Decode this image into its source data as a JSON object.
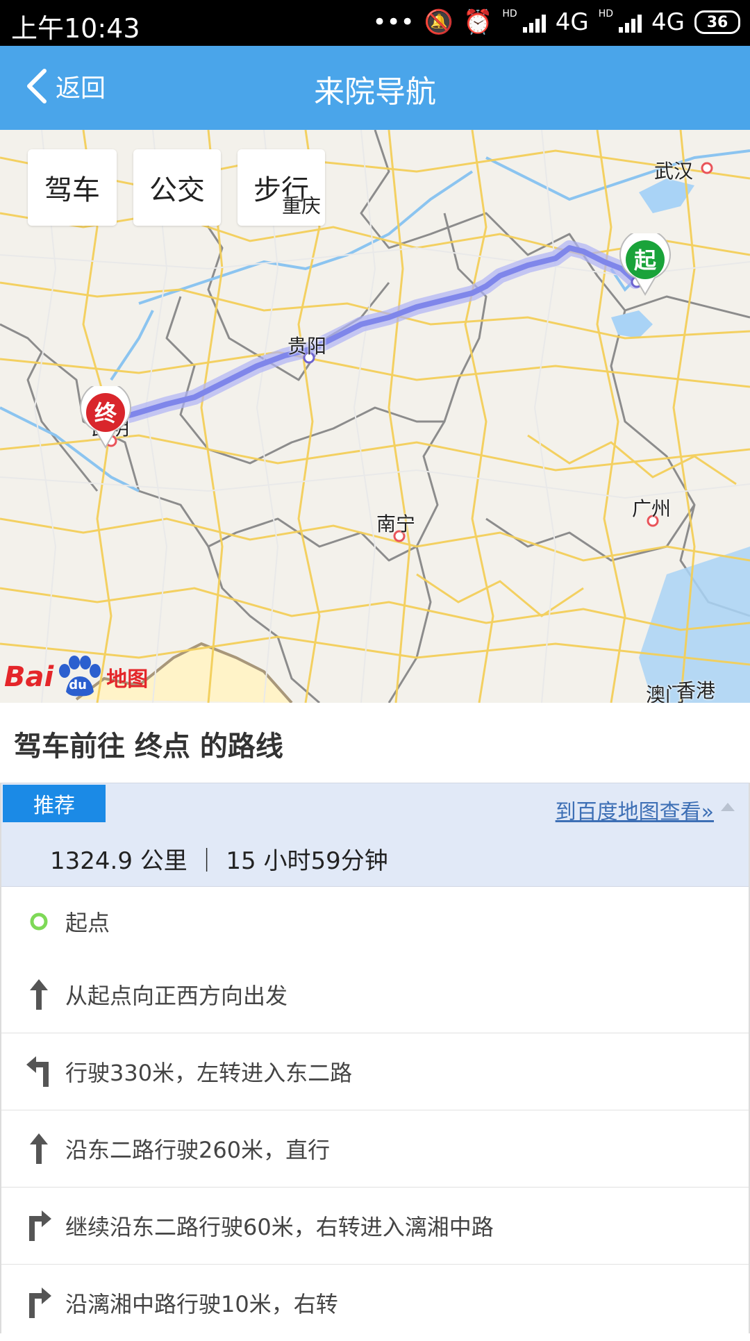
{
  "status_bar": {
    "time": "上午10:43",
    "network_1": "4G",
    "network_2": "4G",
    "hd": "HD",
    "battery": "36"
  },
  "header": {
    "back_label": "返回",
    "title": "来院导航"
  },
  "modes": [
    "驾车",
    "公交",
    "步行"
  ],
  "map": {
    "cities": [
      "武汉",
      "重庆",
      "贵阳",
      "昆明",
      "南宁",
      "广州",
      "澳门",
      "香港"
    ],
    "start_marker": "起",
    "end_marker": "终",
    "logo_text": "Bai",
    "logo_du": "du",
    "logo_suffix": "地图",
    "route_color": "#7f86ea"
  },
  "route": {
    "heading": "驾车前往 终点 的路线",
    "tag": "推荐",
    "map_link": "到百度地图查看»",
    "summary": "1324.9 公里 ｜ 15 小时59分钟"
  },
  "steps": [
    {
      "icon": "start-dot-icon",
      "text": "起点"
    },
    {
      "icon": "arrow-up-icon",
      "text": "从起点向正西方向出发"
    },
    {
      "icon": "turn-left-icon",
      "text": "行驶330米，左转进入东二路"
    },
    {
      "icon": "arrow-up-icon",
      "text": "沿东二路行驶260米，直行"
    },
    {
      "icon": "turn-right-icon",
      "text": "继续沿东二路行驶60米，右转进入漓湘中路"
    },
    {
      "icon": "turn-right-icon",
      "text": "沿漓湘中路行驶10米，右转"
    }
  ],
  "colors": {
    "header": "#4aa5ea",
    "tag": "#1b8ae6",
    "summary_bg": "#e1e9f7",
    "start_pin": "#1aa33a",
    "end_pin": "#d9262c"
  }
}
